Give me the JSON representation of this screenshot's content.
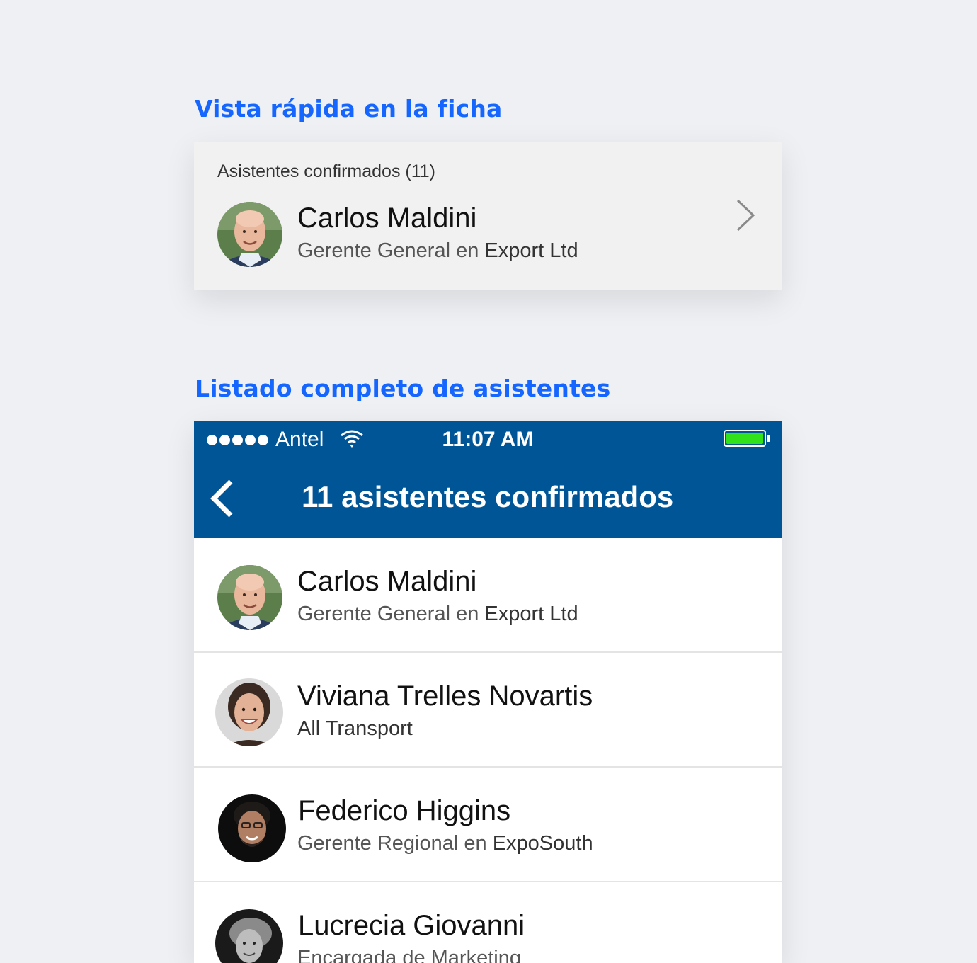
{
  "sections": {
    "quick_view_title": "Vista rápida en la ficha",
    "full_list_title": "Listado completo de asistentes"
  },
  "quick_card": {
    "header": "Asistentes confirmados (11)",
    "name": "Carlos Maldini",
    "role": "Gerente General en",
    "company": "Export Ltd",
    "chevron_icon": "chevron-right-icon"
  },
  "status_bar": {
    "carrier": "Antel",
    "time": "11:07 AM",
    "signal_dots": 5,
    "battery_level": 1.0,
    "battery_color": "#31e11a"
  },
  "nav": {
    "title": "11 asistentes confirmados",
    "back_icon": "chevron-left-icon",
    "background": "#005596"
  },
  "attendees": [
    {
      "name": "Carlos Maldini",
      "role": "Gerente General en",
      "company": "Export Ltd"
    },
    {
      "name": "Viviana Trelles Novartis",
      "role": "",
      "company": "All Transport"
    },
    {
      "name": "Federico Higgins",
      "role": "Gerente Regional en",
      "company": "ExpoSouth"
    },
    {
      "name": "Lucrecia Giovanni",
      "role": "Encargada de Marketing",
      "company": ""
    }
  ],
  "colors": {
    "accent": "#1565ff",
    "page_background": "#eef0f4"
  }
}
